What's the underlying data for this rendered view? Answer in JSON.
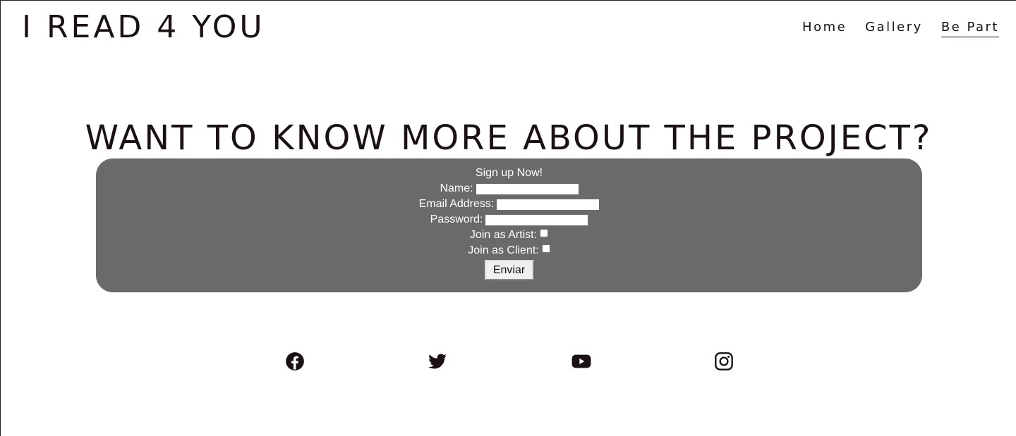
{
  "header": {
    "logo": "I READ 4 YOU",
    "nav": [
      {
        "label": "Home"
      },
      {
        "label": "Gallery"
      },
      {
        "label": "Be Part"
      }
    ]
  },
  "main": {
    "headline": "WANT TO KNOW MORE ABOUT THE PROJECT?"
  },
  "form": {
    "title": "Sign up Now!",
    "name_label": "Name:",
    "name_value": "",
    "email_label": "Email Address:",
    "email_value": "",
    "password_label": "Password:",
    "password_value": "",
    "artist_label": "Join as Artist:",
    "client_label": "Join as Client:",
    "submit_label": "Enviar"
  },
  "social": {
    "icons": [
      "facebook-icon",
      "twitter-icon",
      "youtube-icon",
      "instagram-icon"
    ]
  },
  "colors": {
    "panel": "#6a6a6c",
    "text": "#1a1112"
  }
}
